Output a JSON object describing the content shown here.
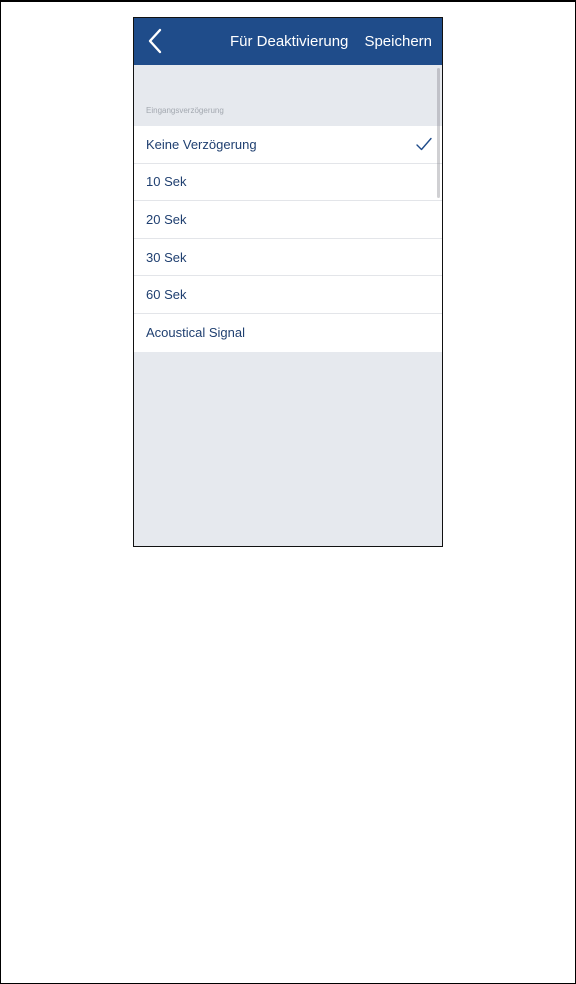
{
  "navbar": {
    "back_icon": "chevron-left-icon",
    "title": "Für Deaktivierung",
    "save_label": "Speichern"
  },
  "section": {
    "header": "Eingangsverzögerung"
  },
  "options": [
    {
      "label": "Keine Verzögerung",
      "selected": true
    },
    {
      "label": "10 Sek",
      "selected": false
    },
    {
      "label": "20 Sek",
      "selected": false
    },
    {
      "label": "30 Sek",
      "selected": false
    },
    {
      "label": "60 Sek",
      "selected": false
    },
    {
      "label": "Acoustical Signal",
      "selected": false
    }
  ],
  "colors": {
    "navbar": "#1f4c8a",
    "list_text": "#1f3f70",
    "background": "#e6e9ee",
    "check": "#1f4c8a"
  }
}
